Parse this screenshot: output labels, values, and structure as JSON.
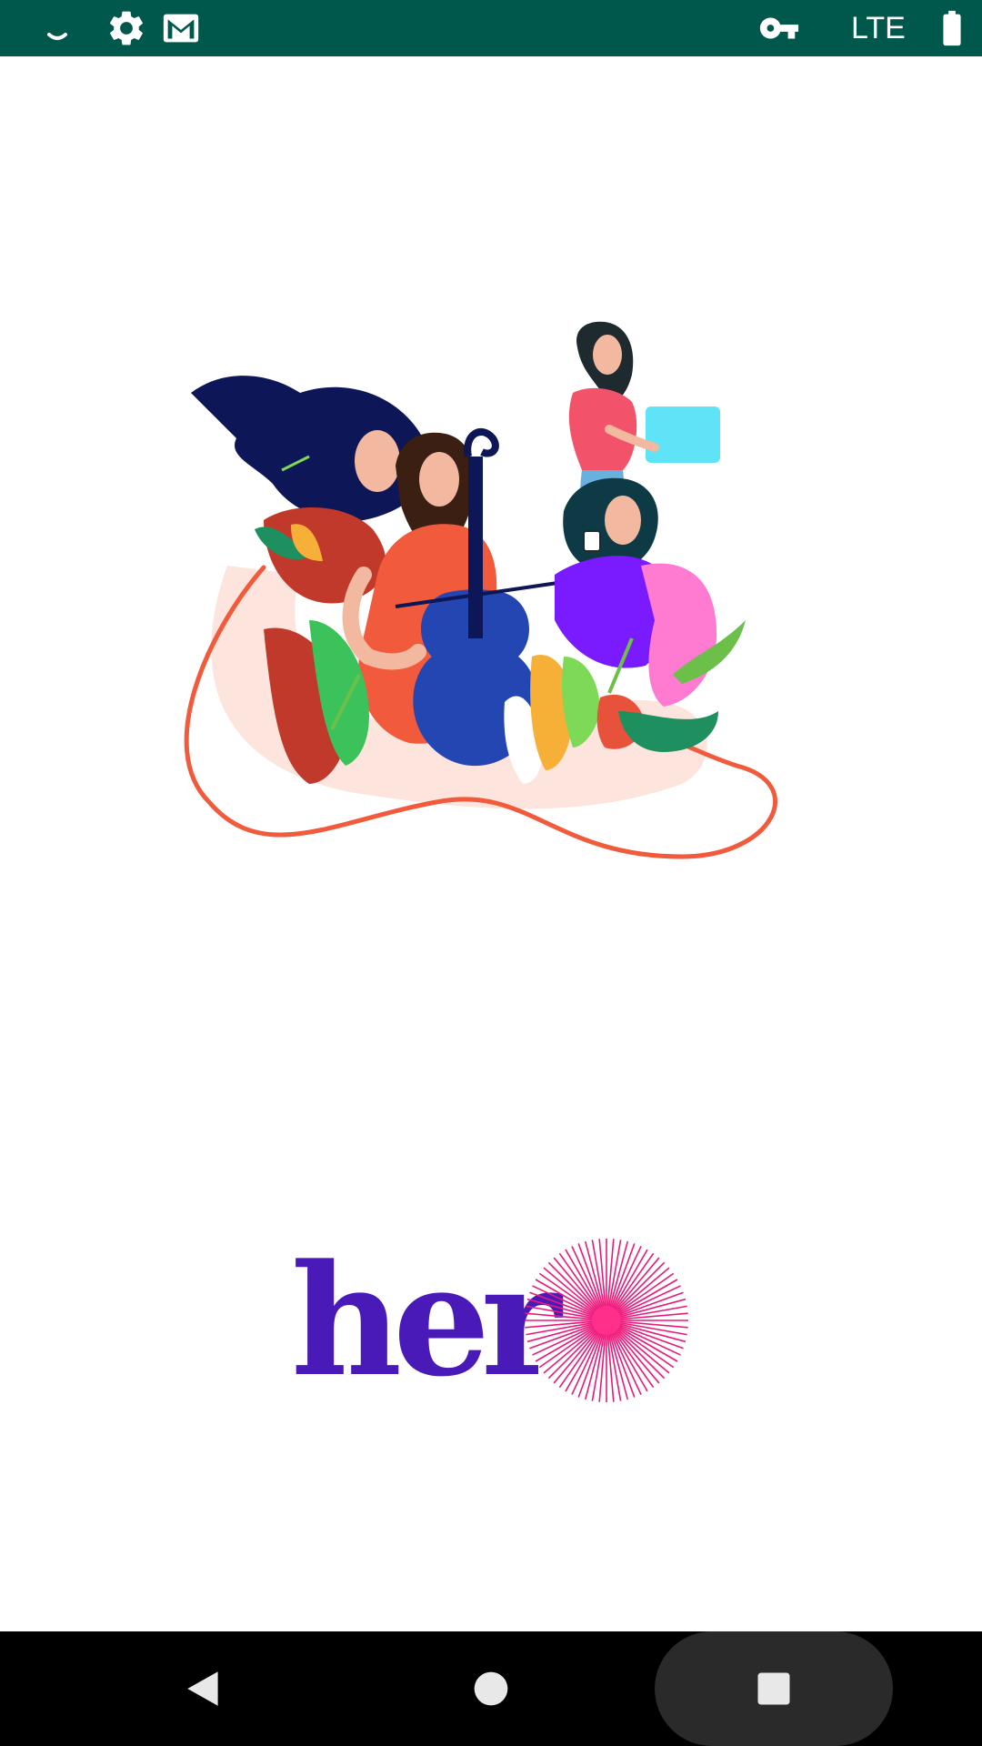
{
  "status_bar": {
    "background": "#00574b",
    "left_icons": [
      "loading-indicator-icon",
      "settings-gear-icon",
      "gmail-icon"
    ],
    "right_icons": [
      "vpn-key-icon",
      "battery-full-icon"
    ],
    "network_label": "LTE"
  },
  "splash": {
    "illustration": "women-with-cello-laptop-coffee-illustration",
    "logo": {
      "text": "her",
      "text_color": "#4a1ab8",
      "burst_color": "#e8197a"
    }
  },
  "nav_bar": {
    "buttons": [
      "back-icon",
      "home-icon",
      "recents-icon"
    ]
  }
}
